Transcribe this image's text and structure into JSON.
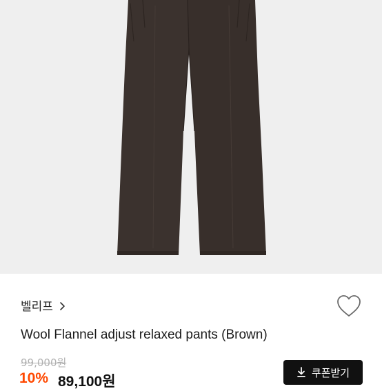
{
  "product": {
    "image_icon": "pants-image",
    "brand": "벨리프",
    "brand_chevron_icon": "chevron-right-icon",
    "wishlist_icon": "heart-outline-icon",
    "title": "Wool Flannel adjust relaxed pants (Brown)",
    "original_price": "99,000원",
    "discount_rate": "10%",
    "sale_price": "89,100원"
  },
  "coupon": {
    "icon": "download-icon",
    "label": "쿠폰받기"
  },
  "colors": {
    "image_background": "#efefef",
    "pants": "#3b322e",
    "discount": "#ff4800",
    "button": "#111111"
  }
}
